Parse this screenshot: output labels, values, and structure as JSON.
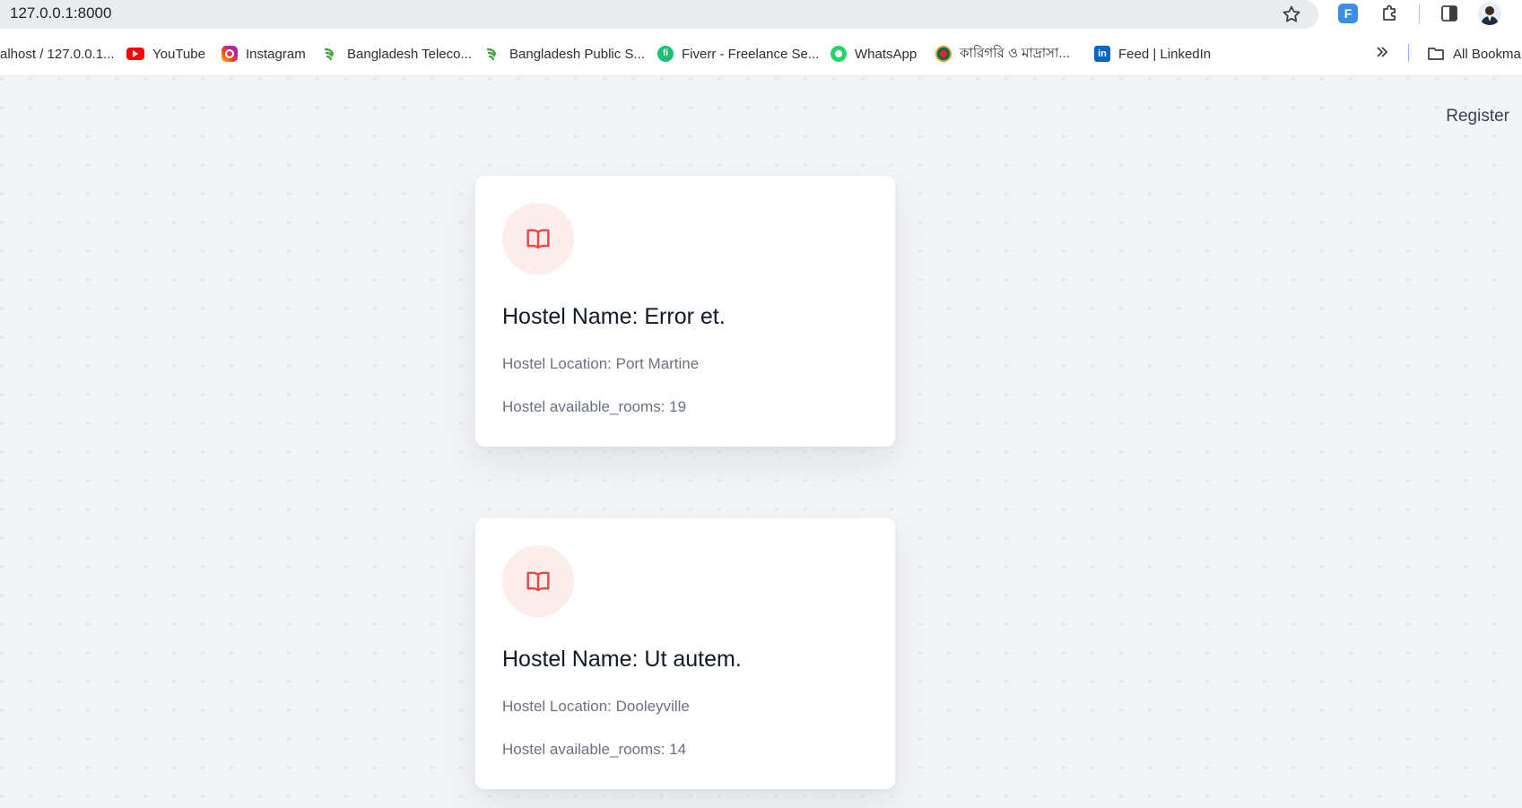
{
  "browser": {
    "url": "127.0.0.1:8000",
    "extension_label": "F"
  },
  "bookmarks": [
    {
      "label": "alhost / 127.0.0.1...",
      "icon": "none"
    },
    {
      "label": "YouTube",
      "icon": "youtube-icon"
    },
    {
      "label": "Instagram",
      "icon": "instagram-icon"
    },
    {
      "label": "Bangladesh Teleco...",
      "icon": "leaf-icon"
    },
    {
      "label": "Bangladesh Public S...",
      "icon": "leaf-icon"
    },
    {
      "label": "Fiverr - Freelance Se...",
      "icon": "fiverr-icon"
    },
    {
      "label": "WhatsApp",
      "icon": "whatsapp-icon"
    },
    {
      "label": "কারিগরি ও মাদ্রাসা...",
      "icon": "bd-govt-icon"
    },
    {
      "label": "Feed | LinkedIn",
      "icon": "linkedin-icon"
    }
  ],
  "all_bookmarks_label": "All Bookma",
  "nav": {
    "register_label": "Register"
  },
  "hostels": [
    {
      "name": "Hostel Name: Error et.",
      "location": "Hostel Location: Port Martine",
      "rooms": "Hostel available_rooms: 19"
    },
    {
      "name": "Hostel Name: Ut autem.",
      "location": "Hostel Location: Dooleyville",
      "rooms": "Hostel available_rooms: 14"
    }
  ],
  "colors": {
    "accent": "#ef4444",
    "icon_bg": "#fdecec",
    "page_bg": "#f3f4f6"
  }
}
